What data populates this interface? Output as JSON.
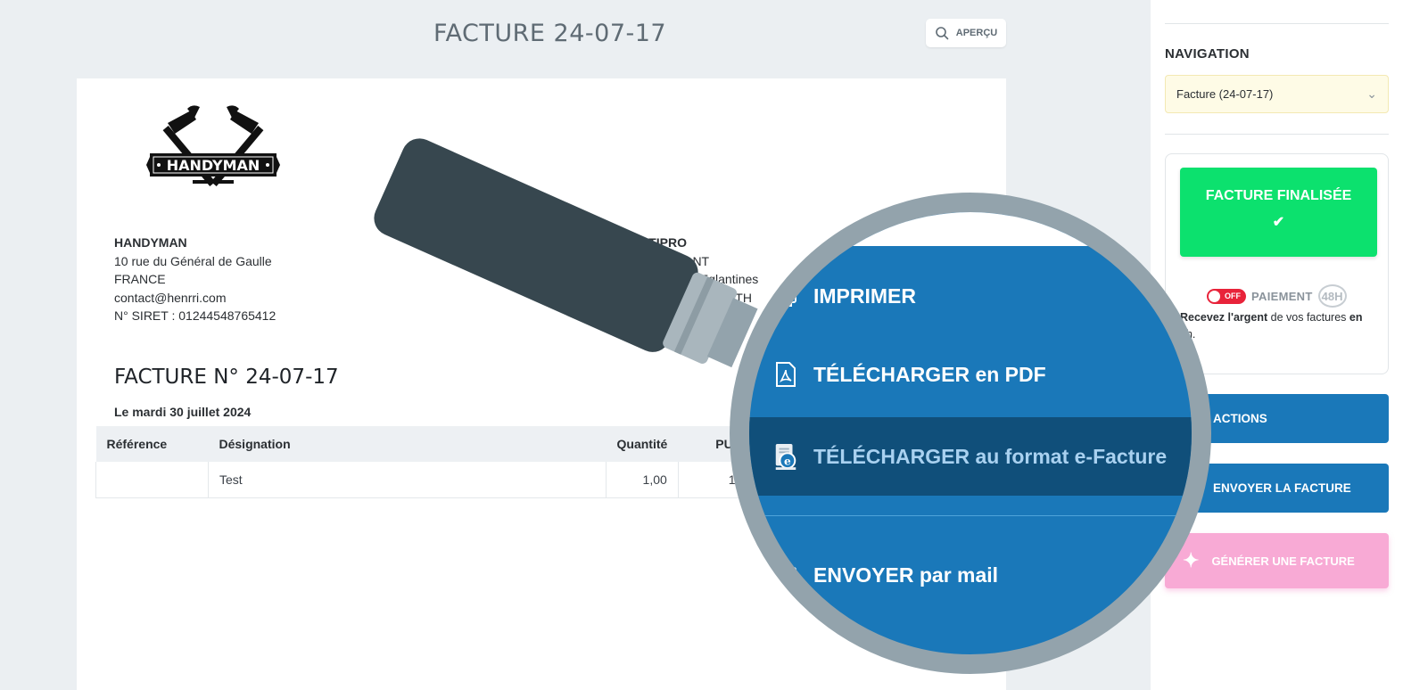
{
  "header": {
    "title": "FACTURE 24-07-17",
    "preview_label": "APERÇU"
  },
  "invoice": {
    "logo_text": "HANDYMAN",
    "company": {
      "name": "HANDYMAN",
      "address": "10 rue du Général de Gaulle",
      "country": "FRANCE",
      "email": "contact@henrri.com",
      "siret": "N° SIRET : 01244548765412"
    },
    "client": {
      "name": "BATIPRO",
      "line1": "DUPONT",
      "line2": "s Eglantines",
      "line3": "ATH"
    },
    "number": "FACTURE N° 24-07-17",
    "date": "Le mardi 30 juillet 2024",
    "columns": [
      "Référence",
      "Désignation",
      "Quantité",
      "PU"
    ],
    "rows": [
      {
        "reference": "",
        "designation": "Test",
        "quantity": "1,00",
        "pu": "1"
      }
    ]
  },
  "sidebar": {
    "nav_label": "NAVIGATION",
    "nav_value": "Facture (24-07-17)",
    "final_label": "FACTURE FINALISÉE",
    "toggle_label": "OFF",
    "payment_label": "PAIEMENT",
    "payment_badge": "48H",
    "payment_desc_bold1": "Recevez l'argent",
    "payment_desc_mid": " de vos factures ",
    "payment_desc_bold2": "en",
    "payment_desc_end": "8h.",
    "actions_label": "ACTIONS",
    "send_label": "ENVOYER LA FACTURE",
    "generate_label": "GÉNÉRER UNE FACTURE"
  },
  "menu": {
    "print": "IMPRIMER",
    "pdf": "TÉLÉCHARGER en PDF",
    "efacture": "TÉLÉCHARGER au format e-Facture",
    "mail": "ENVOYER par mail"
  },
  "colors": {
    "accent_blue": "#1a78b9",
    "success_green": "#0ce16e",
    "pink": "#f8aad5"
  }
}
